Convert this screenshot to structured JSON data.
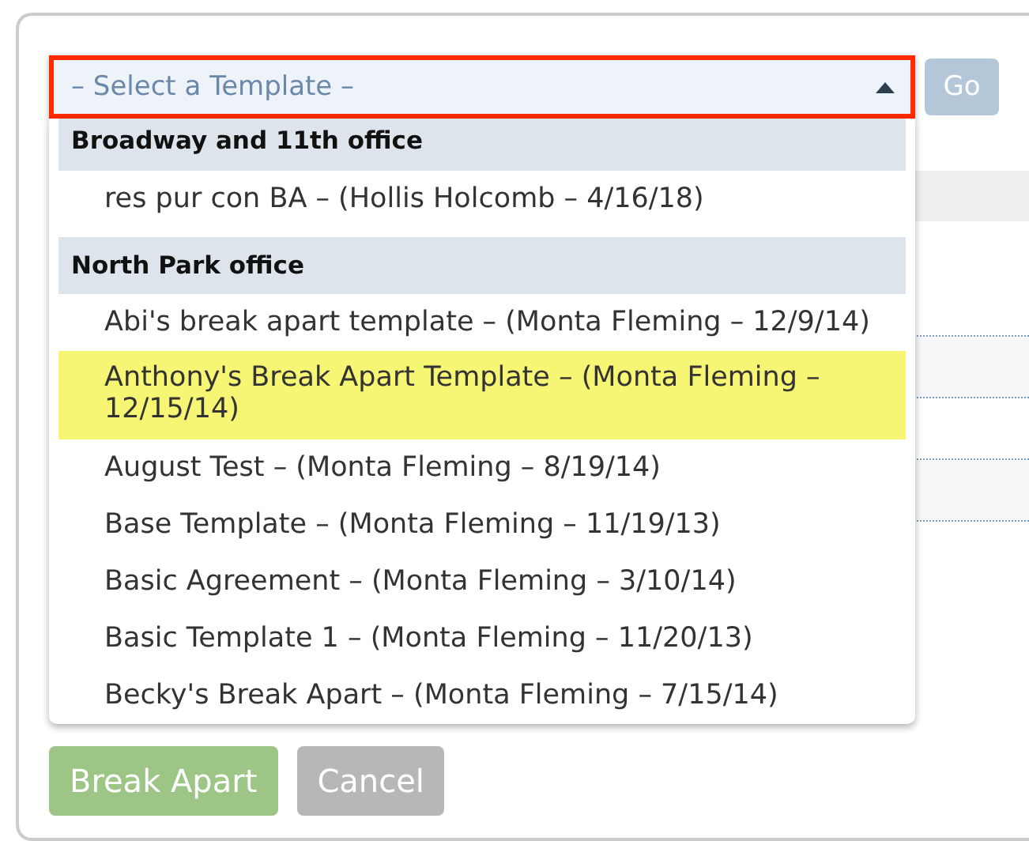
{
  "template_select": {
    "placeholder": "– Select a Template –",
    "expanded": true,
    "highlighted": true
  },
  "go_button": {
    "label": "Go",
    "disabled": true
  },
  "groups": [
    {
      "label": "Broadway and 11th office",
      "items": [
        {
          "label": "res pur con BA – (Hollis Holcomb – 4/16/18)",
          "selected": false
        }
      ]
    },
    {
      "label": "North Park office",
      "items": [
        {
          "label": "Abi's break apart template – (Monta Fleming – 12/9/14)",
          "selected": false
        },
        {
          "label": "Anthony's Break Apart Template – (Monta Fleming – 12/15/14)",
          "selected": true
        },
        {
          "label": "August Test – (Monta Fleming – 8/19/14)",
          "selected": false
        },
        {
          "label": "Base Template – (Monta Fleming – 11/19/13)",
          "selected": false
        },
        {
          "label": "Basic Agreement – (Monta Fleming – 3/10/14)",
          "selected": false
        },
        {
          "label": "Basic Template 1 – (Monta Fleming – 11/20/13)",
          "selected": false
        },
        {
          "label": "Becky's Break Apart – (Monta Fleming – 7/15/14)",
          "selected": false
        }
      ]
    }
  ],
  "actions": [
    {
      "label": "Break Apart",
      "kind": "primary",
      "disabled": true
    },
    {
      "label": "Cancel",
      "kind": "secondary",
      "disabled": false
    }
  ]
}
